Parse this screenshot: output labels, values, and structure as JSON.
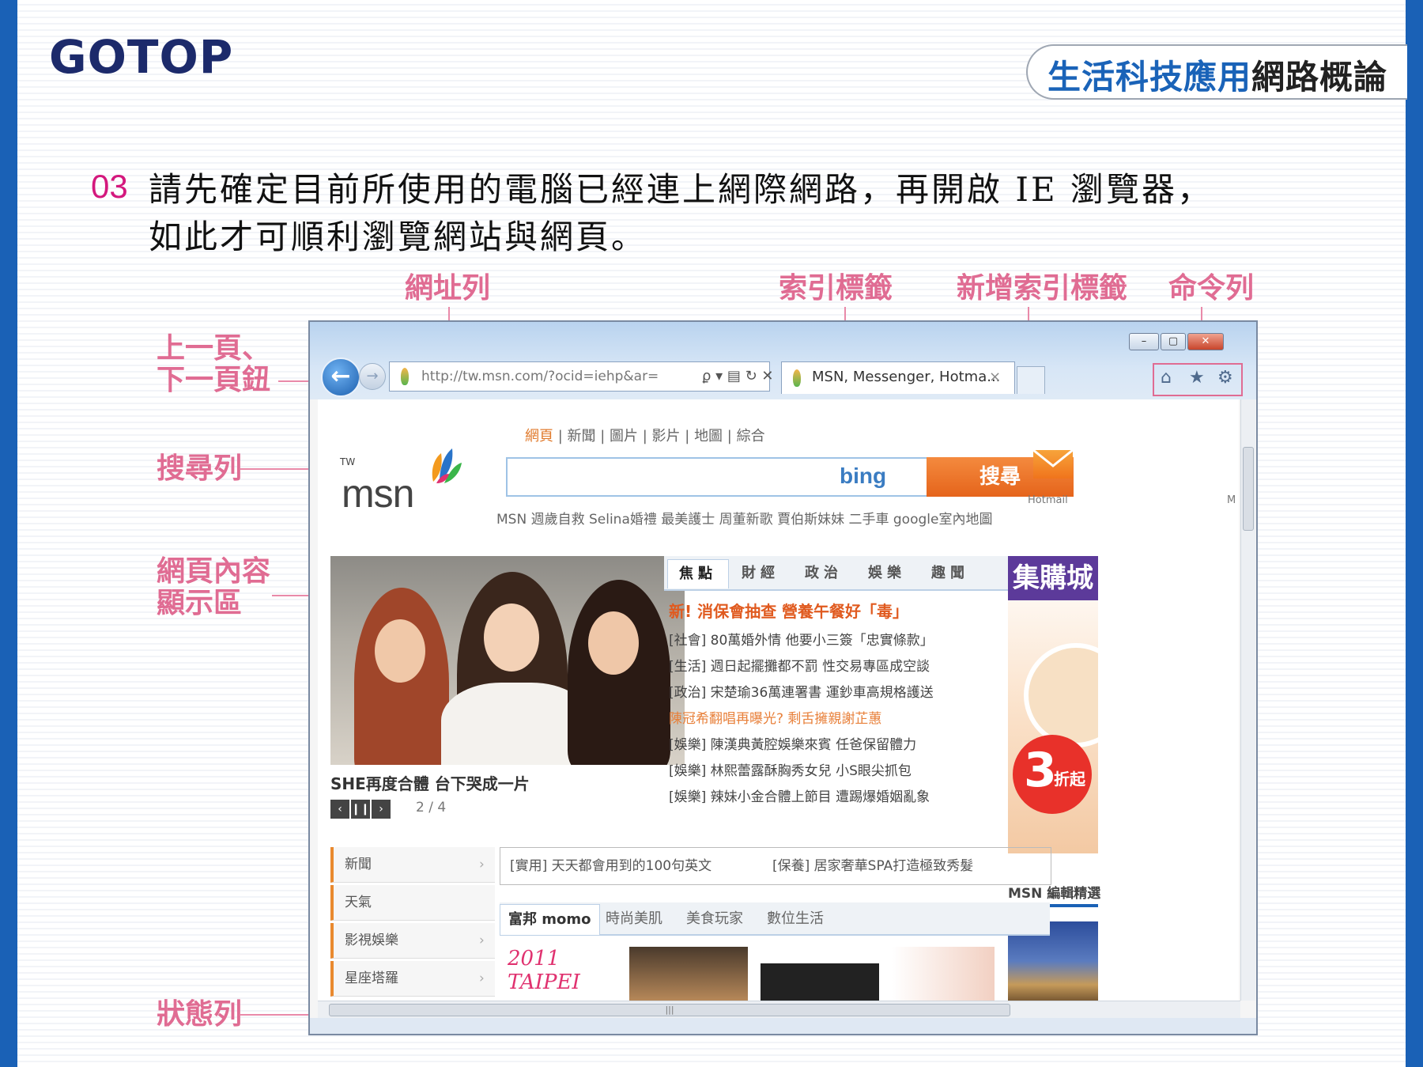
{
  "header": {
    "logo": "GOTOP",
    "book_title_blue": "生活科技應用",
    "book_title_dark": "網路概論"
  },
  "step": {
    "number": "03",
    "line1": "請先確定目前所使用的電腦已經連上網際網路，再開啟 IE 瀏覽器，",
    "line2": "如此才可順利瀏覽網站與網頁。"
  },
  "callouts": {
    "address_bar": "網址列",
    "tab": "索引標籤",
    "new_tab": "新增索引標籤",
    "command_bar": "命令列",
    "back_forward_1": "上一頁、",
    "back_forward_2": "下一頁鈕",
    "search_bar": "搜尋列",
    "content_1": "網頁內容",
    "content_2": "顯示區",
    "status_bar": "狀態列"
  },
  "browser": {
    "url": "http://tw.msn.com/?ocid=iehp&ar=",
    "tab_title": "MSN, Messenger, Hotma...",
    "address_controls": "ϼ ▾ ▤ ↻ ✕",
    "win_min": "–",
    "win_max": "▢",
    "win_close": "✕",
    "back_symbol": "←",
    "forward_symbol": "→",
    "tab_close": "×",
    "cmd_icons": [
      "⌂",
      "★",
      "⚙"
    ],
    "accent_color": "#e06c93"
  },
  "msn": {
    "region": "TW",
    "logo": "msn",
    "nav": [
      "網頁",
      "新聞",
      "圖片",
      "影片",
      "地圖",
      "綜合"
    ],
    "bing": "bing",
    "search_button": "搜尋",
    "trending": "MSN 週歲自救   Selina婚禮   最美護士   周董新歌   賈伯斯妹妹   二手車   google室內地圖",
    "hotmail": "Hotmail",
    "hotmail_partial": "M",
    "photo_caption": "SHE再度合體 台下哭成一片",
    "page_indicator": "2 / 4",
    "pager": [
      "‹",
      "❙❙",
      "›"
    ],
    "news_tabs": [
      "焦點",
      "財經",
      "政治",
      "娛樂",
      "趣聞"
    ],
    "headline": "新! 消保會抽查 營養午餐好「毒」",
    "news": [
      "[社會] 80萬婚外情 他要小三簽「忠實條款」",
      "[生活] 週日起擺攤都不罰 性交易專區成空談",
      "[政治] 宋楚瑜36萬連署書 運鈔車高規格護送",
      "陳冠希翻唱再曝光? 剩舌擁親謝芷蕙",
      "[娛樂] 陳漢典黃腔娛樂來賓 任爸保留體力",
      "[娛樂] 林熙蕾露酥胸秀女兒 小S眼尖抓包",
      "[娛樂] 辣妹小金合體上節目 遭踢爆婚姻亂象"
    ],
    "side_menu": [
      "新聞",
      "天氣",
      "影視娛樂",
      "星座塔羅"
    ],
    "promo1": "[實用] 天天都會用到的100句英文",
    "promo2": "[保養] 居家奢華SPA打造極致秀髮",
    "shop_tabs": [
      "富邦 momo",
      "時尚美肌",
      "美食玩家",
      "數位生活"
    ],
    "ad_title": "集購城",
    "ad_badge_num": "3",
    "ad_badge_txt": "折起",
    "editor_pick": "MSN 編輯精選",
    "taipei_ad": "2011 TAIPEI"
  }
}
